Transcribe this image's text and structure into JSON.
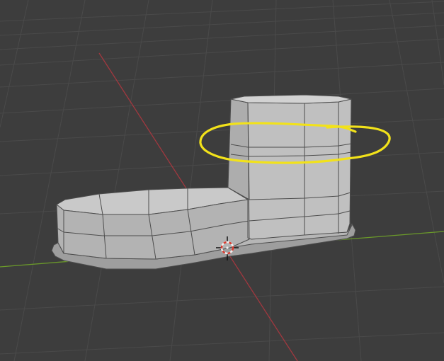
{
  "viewport": {
    "background": "#3d3d3d",
    "grid_color": "#4a4a4a",
    "x_axis_color": "#a1383f",
    "y_axis_color": "#6b9a2a"
  },
  "model": {
    "icon": "boot-mesh-icon",
    "face_light": "#c4c4c4",
    "face_mid": "#b0b0b0",
    "face_dark": "#9a9a9a",
    "edge_color": "#4d4d4d"
  },
  "annotation": {
    "icon": "yellow-loop-annotation-icon",
    "color": "#f2e21a"
  },
  "cursor": {
    "icon": "3d-cursor-icon",
    "ring_red": "#d83a2e",
    "ring_white": "#f0f0f0"
  }
}
